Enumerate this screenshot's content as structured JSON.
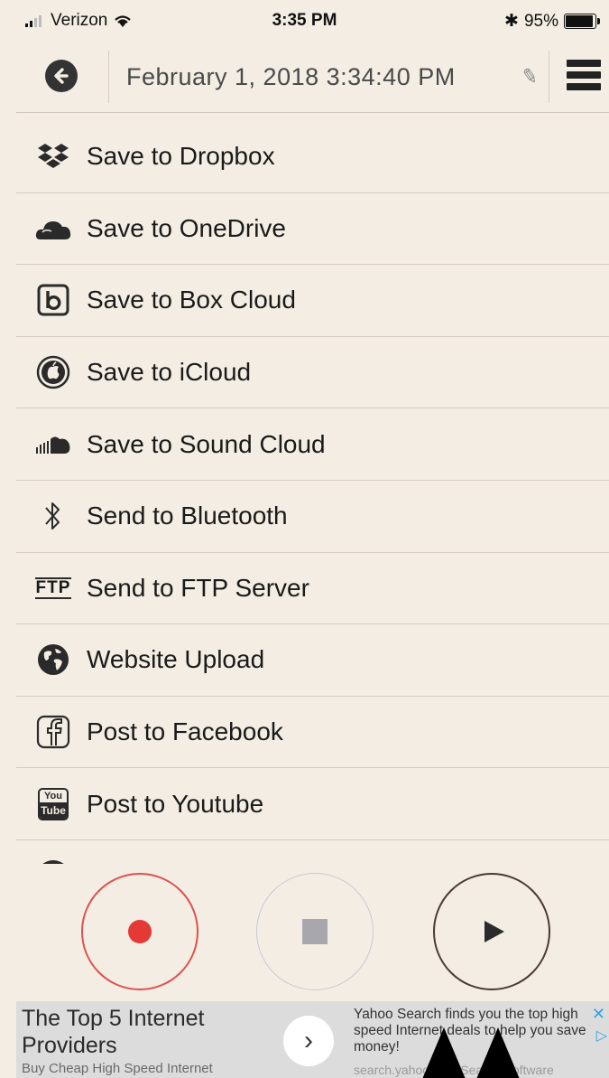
{
  "status_bar": {
    "carrier": "Verizon",
    "time": "3:35 PM",
    "battery": "95%",
    "battery_level": 0.95
  },
  "nav": {
    "title": "February 1, 2018 3:34:40 PM"
  },
  "menu": {
    "items": [
      {
        "label": "Save to Dropbox",
        "icon": "dropbox-icon"
      },
      {
        "label": "Save to OneDrive",
        "icon": "onedrive-icon"
      },
      {
        "label": "Save to Box Cloud",
        "icon": "box-icon"
      },
      {
        "label": "Save to iCloud",
        "icon": "apple-icon"
      },
      {
        "label": "Save to Sound Cloud",
        "icon": "soundcloud-icon"
      },
      {
        "label": "Send to Bluetooth",
        "icon": "bluetooth-icon"
      },
      {
        "label": "Send to FTP Server",
        "icon": "ftp-icon",
        "icon_text": "FTP"
      },
      {
        "label": "Website Upload",
        "icon": "globe-icon"
      },
      {
        "label": "Post to Facebook",
        "icon": "facebook-icon"
      },
      {
        "label": "Post to Youtube",
        "icon": "youtube-icon",
        "icon_text_top": "You",
        "icon_text_bottom": "Tube"
      }
    ]
  },
  "controls": {
    "record_color": "#e53935",
    "stop_color": "#a7a7ad",
    "play_color": "#2b2b2b"
  },
  "ad": {
    "headline": "The Top 5 Internet Providers",
    "subline": "Buy Cheap High Speed Internet",
    "body": "Yahoo Search finds you the top high speed Internet deals to help you save money!",
    "url": "search.yahoo.com/Search/Software",
    "arrow": "›"
  }
}
